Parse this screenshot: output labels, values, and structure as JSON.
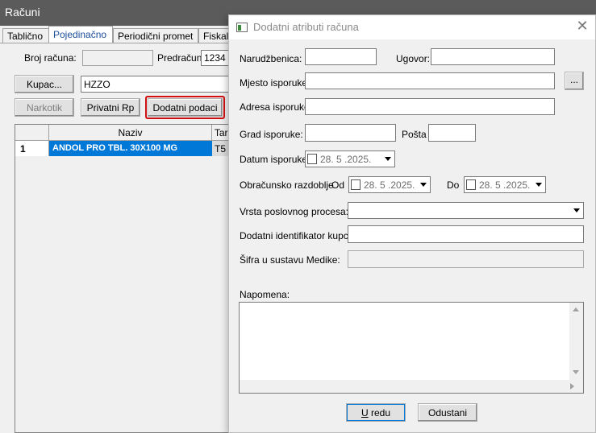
{
  "window": {
    "title": "Računi"
  },
  "tabs": [
    {
      "label": "Tablično"
    },
    {
      "label": "Pojedinačno"
    },
    {
      "label": "Periodični promet"
    },
    {
      "label": "Fiskali"
    }
  ],
  "main": {
    "broj_racuna_label": "Broj računa:",
    "broj_racuna_value": "",
    "predracun_label": "Predračun:",
    "predracun_value": "1234",
    "kupac_button": "Kupac...",
    "kupac_value": "HZZO",
    "narkotik_button": "Narkotik",
    "privatni_rp_button": "Privatni Rp",
    "dodatni_podaci_button": "Dodatni podaci",
    "grid": {
      "headers": [
        "Naziv",
        "Tari"
      ],
      "rows": [
        {
          "num": "1",
          "naziv": "ANDOL PRO TBL. 30X100 MG",
          "tarif": "T5"
        }
      ]
    }
  },
  "dialog": {
    "title": "Dodatni atributi računa",
    "narudzbenica_label": "Narudžbenica:",
    "narudzbenica_value": "",
    "ugovor_label": "Ugovor:",
    "ugovor_value": "",
    "mjesto_label": "Mjesto isporuke:",
    "mjesto_value": "",
    "browse_label": "...",
    "adresa_label": "Adresa isporuke:",
    "adresa_value": "",
    "grad_label": "Grad isporuke:",
    "grad_value": "",
    "posta_label": "Pošta",
    "posta_value": "",
    "datum_label": "Datum isporuke:",
    "datum_value": "28. 5 .2025.",
    "obracunsko_label": "Obračunsko razdoblje",
    "od_label": "Od",
    "od_value": "28. 5 .2025.",
    "do_label": "Do",
    "do_value": "28. 5 .2025.",
    "vrsta_label": "Vrsta poslovnog procesa:",
    "vrsta_value": "",
    "identifikator_label": "Dodatni identifikator kupca:",
    "identifikator_value": "",
    "sifra_label": "Šifra u sustavu Medike:",
    "sifra_value": "",
    "napomena_label": "Napomena:",
    "napomena_value": "",
    "ok_button_u": "U",
    "ok_button_rest": " redu",
    "cancel_button": "Odustani"
  },
  "colors": {
    "titlebar": "#5b5b5b",
    "selection": "#0078d7",
    "highlight_border": "#d01010",
    "active_tab_text": "#1c4f9c"
  }
}
